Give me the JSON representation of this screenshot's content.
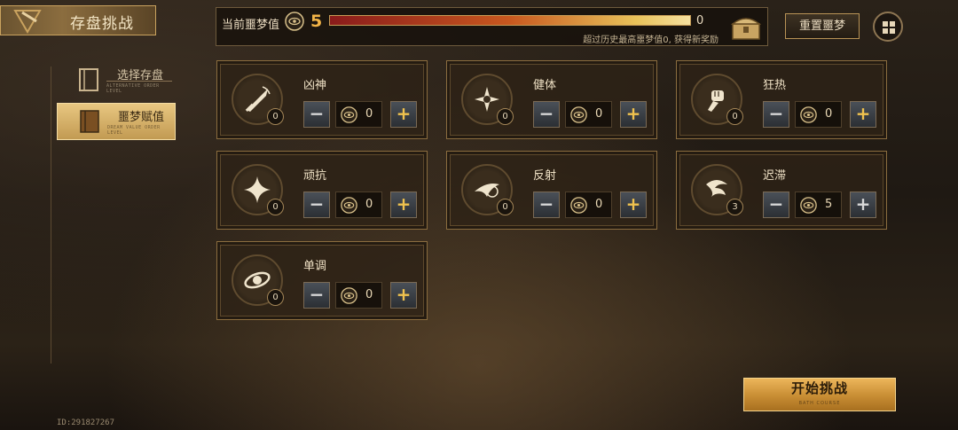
{
  "header": {
    "title": "存盘挑战"
  },
  "nav": {
    "items": [
      {
        "label": "选择存盘",
        "sub": "ALTERNATIVE ORDER LEVEL",
        "active": false
      },
      {
        "label": "噩梦赋值",
        "sub": "DREAM VALUE ORDER LEVEL",
        "active": true
      }
    ]
  },
  "value_bar": {
    "label": "当前噩梦值",
    "current": "5",
    "max": "0",
    "fill_fraction": 1.0,
    "note": "超过历史最高噩梦值0, 获得新奖励"
  },
  "buttons": {
    "reset": "重置噩梦",
    "start": "开始挑战",
    "start_sub": "BATH COURSE"
  },
  "cards": [
    {
      "name": "凶神",
      "level": "0",
      "value": "0",
      "icon": "dagger-icon"
    },
    {
      "name": "健体",
      "level": "0",
      "value": "0",
      "icon": "lotus-icon"
    },
    {
      "name": "狂热",
      "level": "0",
      "value": "0",
      "icon": "fist-icon"
    },
    {
      "name": "顽抗",
      "level": "0",
      "value": "0",
      "icon": "star-icon"
    },
    {
      "name": "反射",
      "level": "0",
      "value": "0",
      "icon": "swoop-icon"
    },
    {
      "name": "迟滞",
      "level": "3",
      "value": "5",
      "icon": "swirl-icon"
    },
    {
      "name": "单调",
      "level": "0",
      "value": "0",
      "icon": "orbit-icon"
    }
  ],
  "controls": {
    "minus": "−",
    "plus": "+"
  },
  "footer": {
    "id_text": "ID:291827267"
  },
  "colors": {
    "accent_gold": "#f2b447",
    "frame_gold": "#8b6d3f"
  }
}
